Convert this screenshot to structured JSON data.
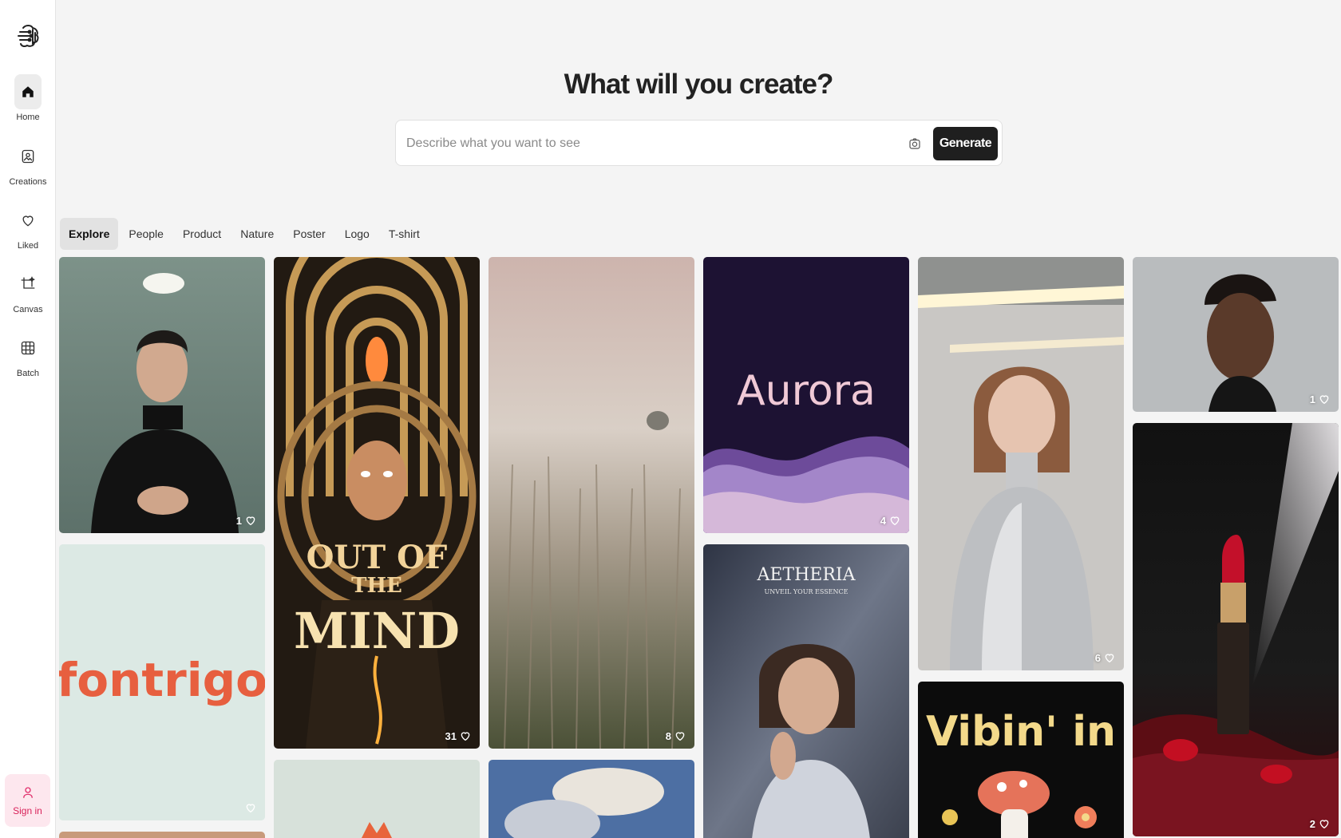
{
  "sidebar": {
    "items": [
      {
        "label": "Home",
        "icon": "home-icon",
        "active": true
      },
      {
        "label": "Creations",
        "icon": "image-icon",
        "active": false
      },
      {
        "label": "Liked",
        "icon": "heart-icon",
        "active": false
      },
      {
        "label": "Canvas",
        "icon": "crop-icon",
        "active": false
      },
      {
        "label": "Batch",
        "icon": "grid-icon",
        "active": false
      }
    ],
    "signin_label": "Sign in"
  },
  "hero": {
    "headline": "What will you create?",
    "search_placeholder": "Describe what you want to see",
    "generate_label": "Generate"
  },
  "tabs": [
    "Explore",
    "People",
    "Product",
    "Nature",
    "Poster",
    "Logo",
    "T-shirt"
  ],
  "gallery": {
    "cards": [
      {
        "subject": "man-in-black-turtleneck",
        "likes": "1"
      },
      {
        "subject": "fontrigo-logo",
        "likes": "",
        "text": "fontrigo"
      },
      {
        "subject": "out-of-the-mind-poster",
        "likes": "31",
        "text_lines": [
          "OUT OF",
          "THE",
          "MIND"
        ]
      },
      {
        "subject": "misty-wheat-field",
        "likes": "8"
      },
      {
        "subject": "aurora-logo",
        "likes": "4",
        "text": "Aurora"
      },
      {
        "subject": "aetheria-portrait",
        "likes": "",
        "text": "AETHERIA",
        "subtext": "UNVEIL YOUR ESSENCE"
      },
      {
        "subject": "silver-top-woman",
        "likes": "6"
      },
      {
        "subject": "vibin-tshirt",
        "likes": "",
        "text": "Vibin' in"
      },
      {
        "subject": "man-portrait",
        "likes": "1"
      },
      {
        "subject": "red-lipstick",
        "likes": "2"
      }
    ]
  },
  "colors": {
    "accent": "#1f1f1f",
    "signin": "#e1306c",
    "background": "#f4f4f4"
  }
}
